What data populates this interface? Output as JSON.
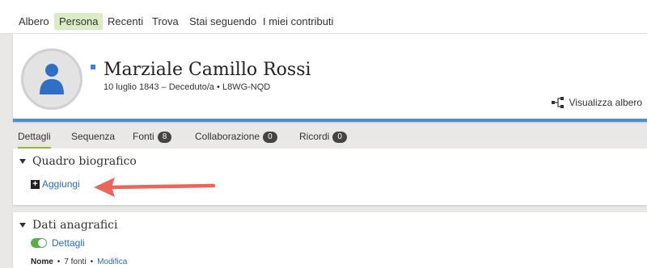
{
  "topnav": {
    "items": [
      "Albero",
      "Persona",
      "Recenti",
      "Trova",
      "Stai seguendo",
      "I miei contributi"
    ],
    "active": "Persona"
  },
  "person": {
    "name": "Marziale Camillo Rossi",
    "info": "10 luglio 1843 – Deceduto/a • L8WG-NQD",
    "view_tree": "Visualizza albero"
  },
  "tabs": [
    {
      "label": "Dettagli"
    },
    {
      "label": "Sequenza"
    },
    {
      "label": "Fonti",
      "count": "8"
    },
    {
      "label": "Collaborazione",
      "count": "0"
    },
    {
      "label": "Ricordi",
      "count": "0"
    }
  ],
  "bio_section": {
    "title": "Quadro biografico",
    "add_label": "Aggiungi"
  },
  "vitals_section": {
    "title": "Dati anagrafici",
    "toggle_label": "Dettagli",
    "name_label": "Nome",
    "sources": "7 fonti",
    "edit": "Modifica"
  },
  "colors": {
    "accent_blue": "#4a90d6",
    "active_tab_underline": "#8cb942",
    "arrow": "#e8675a",
    "toggle_on": "#56b04a"
  }
}
